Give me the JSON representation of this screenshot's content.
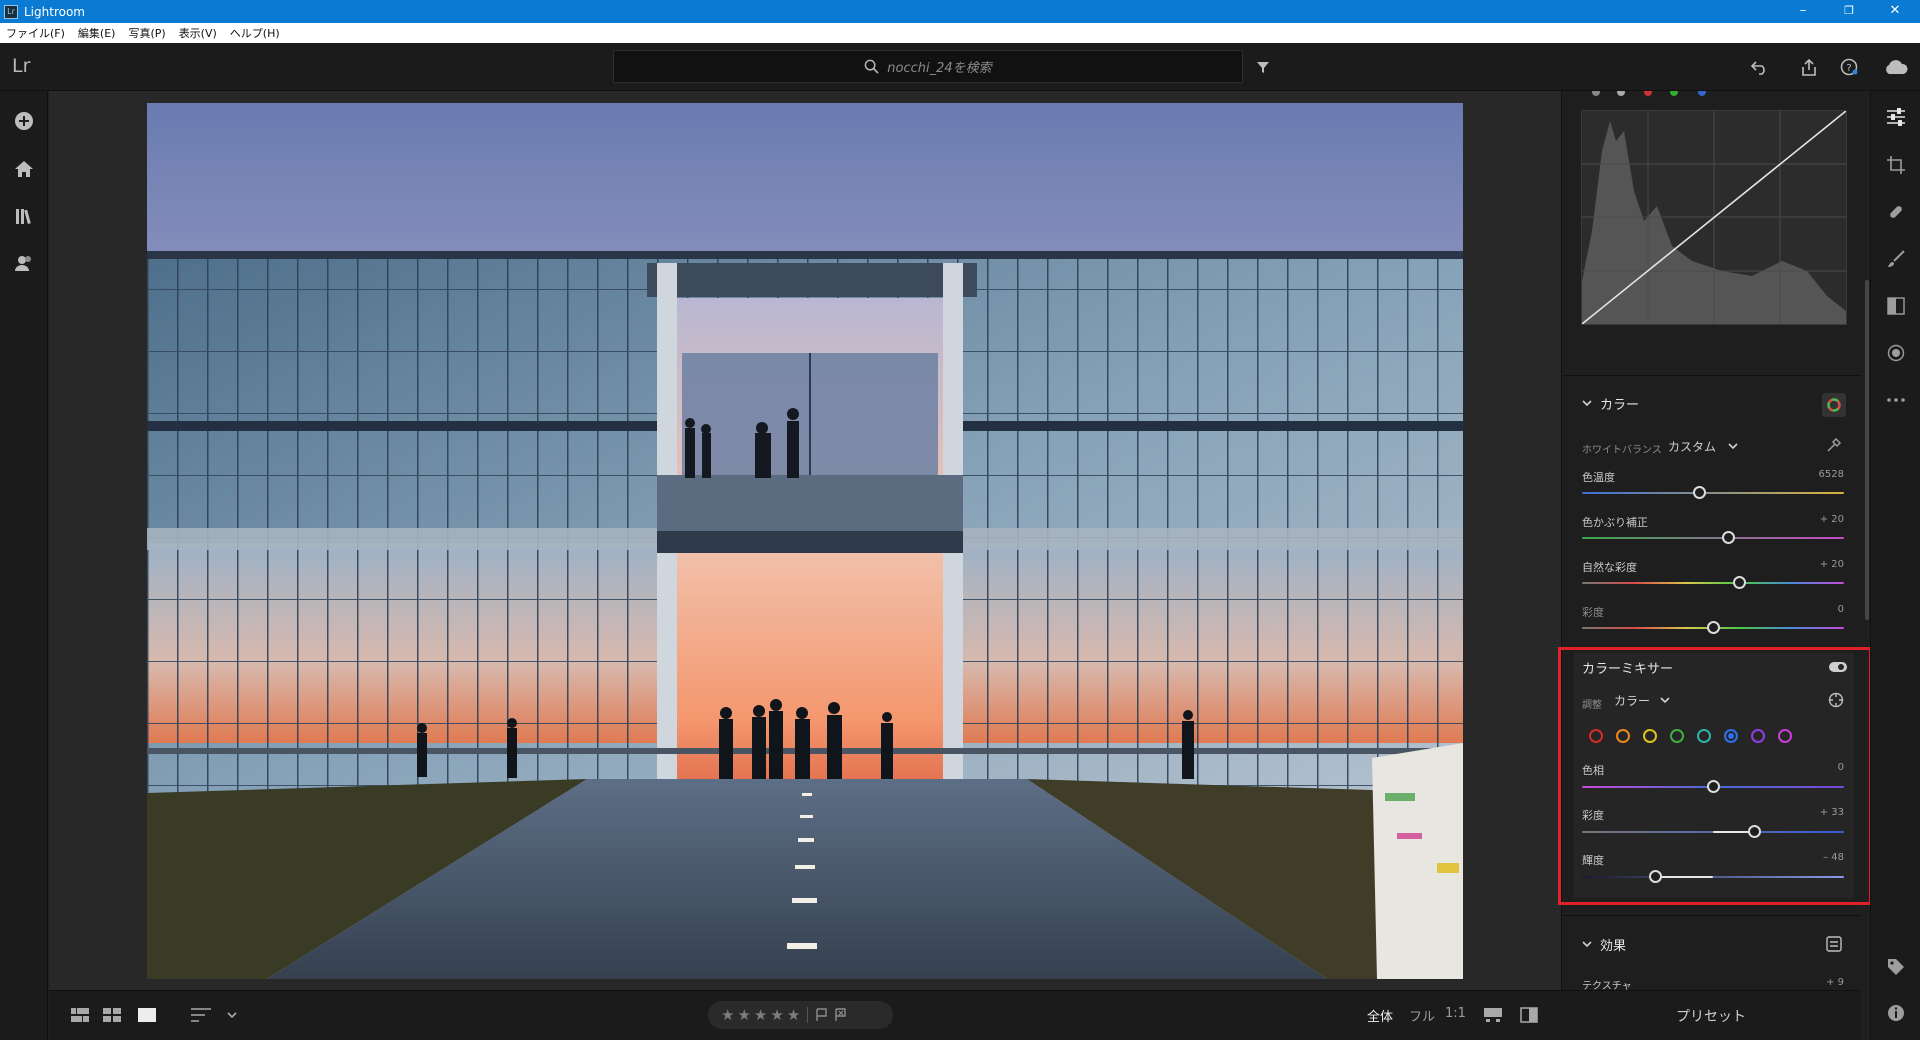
{
  "window": {
    "title": "Lightroom",
    "minimize": "–",
    "restore": "❐",
    "close": "✕"
  },
  "menu": [
    "ファイル(F)",
    "編集(E)",
    "写真(P)",
    "表示(V)",
    "ヘルプ(H)"
  ],
  "toolbar": {
    "logo": "Lr",
    "search_placeholder": "nocchi_24を検索"
  },
  "bottom": {
    "stars": [
      "★",
      "★",
      "★",
      "★",
      "★"
    ],
    "zoom_options": [
      "全体",
      "フル",
      "1:1"
    ]
  },
  "panel": {
    "color": {
      "title": "カラー",
      "wb_label": "ホワイトバランス",
      "wb_value": "カスタム",
      "sliders": [
        {
          "label": "色温度",
          "value": "6528",
          "pos": 0.45
        },
        {
          "label": "色かぶり補正",
          "value": "+ 20",
          "pos": 0.56
        },
        {
          "label": "自然な彩度",
          "value": "+ 20",
          "pos": 0.6
        },
        {
          "label": "彩度",
          "value": "0",
          "pos": 0.5
        }
      ]
    },
    "mixer": {
      "title": "カラーミキサー",
      "adjust_label": "調整",
      "adjust_value": "カラー",
      "colors": [
        "#d32a2a",
        "#e88a1c",
        "#e0c21c",
        "#3fb03f",
        "#2fb2a8",
        "#2f6ee8",
        "#8a3fe0",
        "#c83fd8"
      ],
      "selected_color": 5,
      "sliders": [
        {
          "label": "色相",
          "value": "0",
          "pos": 0.5
        },
        {
          "label": "彩度",
          "value": "+ 33",
          "pos": 0.66
        },
        {
          "label": "輝度",
          "value": "– 48",
          "pos": 0.28
        }
      ]
    },
    "effects": {
      "title": "効果",
      "first_item": "テクスチャ",
      "first_value": "+ 9"
    },
    "preset_label": "プリセット"
  }
}
